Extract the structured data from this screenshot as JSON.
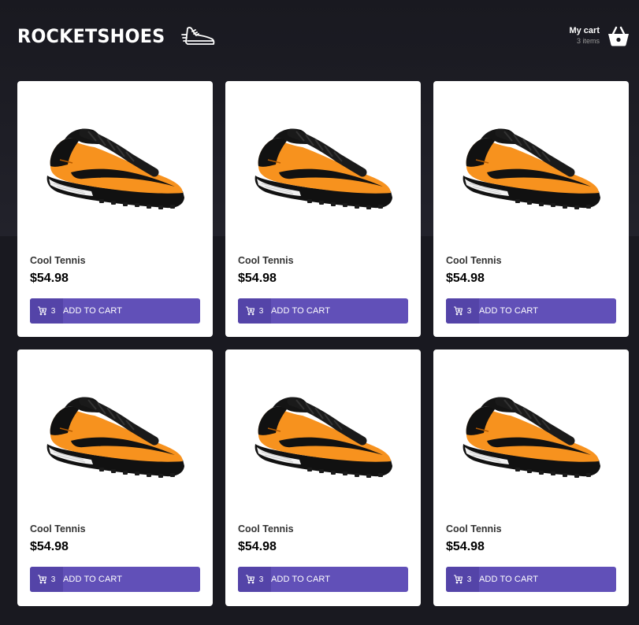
{
  "header": {
    "brand": "ROCKETSHOES",
    "logo_icon": "sneaker-icon",
    "cart": {
      "title": "My cart",
      "count_text": "3 items",
      "icon": "basket-icon"
    }
  },
  "colors": {
    "background": "#191920",
    "button": "#6150b8",
    "button_dark": "#5444a8",
    "shoe_orange": "#f7921e"
  },
  "products": [
    {
      "name": "Cool Tennis",
      "price": "$54.98",
      "cart_qty": "3",
      "button_label": "ADD TO CART"
    },
    {
      "name": "Cool Tennis",
      "price": "$54.98",
      "cart_qty": "3",
      "button_label": "ADD TO CART"
    },
    {
      "name": "Cool Tennis",
      "price": "$54.98",
      "cart_qty": "3",
      "button_label": "ADD TO CART"
    },
    {
      "name": "Cool Tennis",
      "price": "$54.98",
      "cart_qty": "3",
      "button_label": "ADD TO CART"
    },
    {
      "name": "Cool Tennis",
      "price": "$54.98",
      "cart_qty": "3",
      "button_label": "ADD TO CART"
    },
    {
      "name": "Cool Tennis",
      "price": "$54.98",
      "cart_qty": "3",
      "button_label": "ADD TO CART"
    }
  ]
}
